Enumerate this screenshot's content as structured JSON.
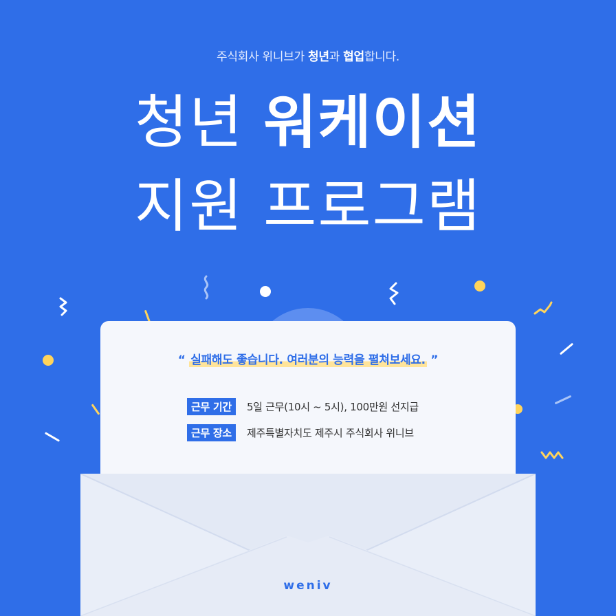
{
  "header": {
    "subtitle_pre": "주식회사 위니브가 ",
    "subtitle_b1": "청년",
    "subtitle_mid": "과 ",
    "subtitle_b2": "협업",
    "subtitle_post": "합니다."
  },
  "title": {
    "line1_thin": "청년 ",
    "line1_bold": "워케이션",
    "line2": "지원 프로그램"
  },
  "letter": {
    "quote_open": "“ ",
    "quote_text": "실패해도 좋습니다. 여러분의 능력을 펼쳐보세요.",
    "quote_close": " ”",
    "rows": [
      {
        "tag": "근무 기간",
        "text": "5일 근무(10시 ~ 5시), 100만원 선지급"
      },
      {
        "tag": "근무 장소",
        "text": "제주특별자치도 제주시 주식회사 위니브"
      }
    ]
  },
  "brand": {
    "logo": "weniv"
  },
  "colors": {
    "background": "#2f6ee8",
    "accent_yellow": "#ffd45c",
    "highlight": "#ffe49a",
    "paper": "#f5f7fc",
    "envelope": "#e8edf7"
  },
  "decorations": [
    "confetti-squiggle-icon",
    "confetti-dot-icon",
    "confetti-line-icon"
  ]
}
